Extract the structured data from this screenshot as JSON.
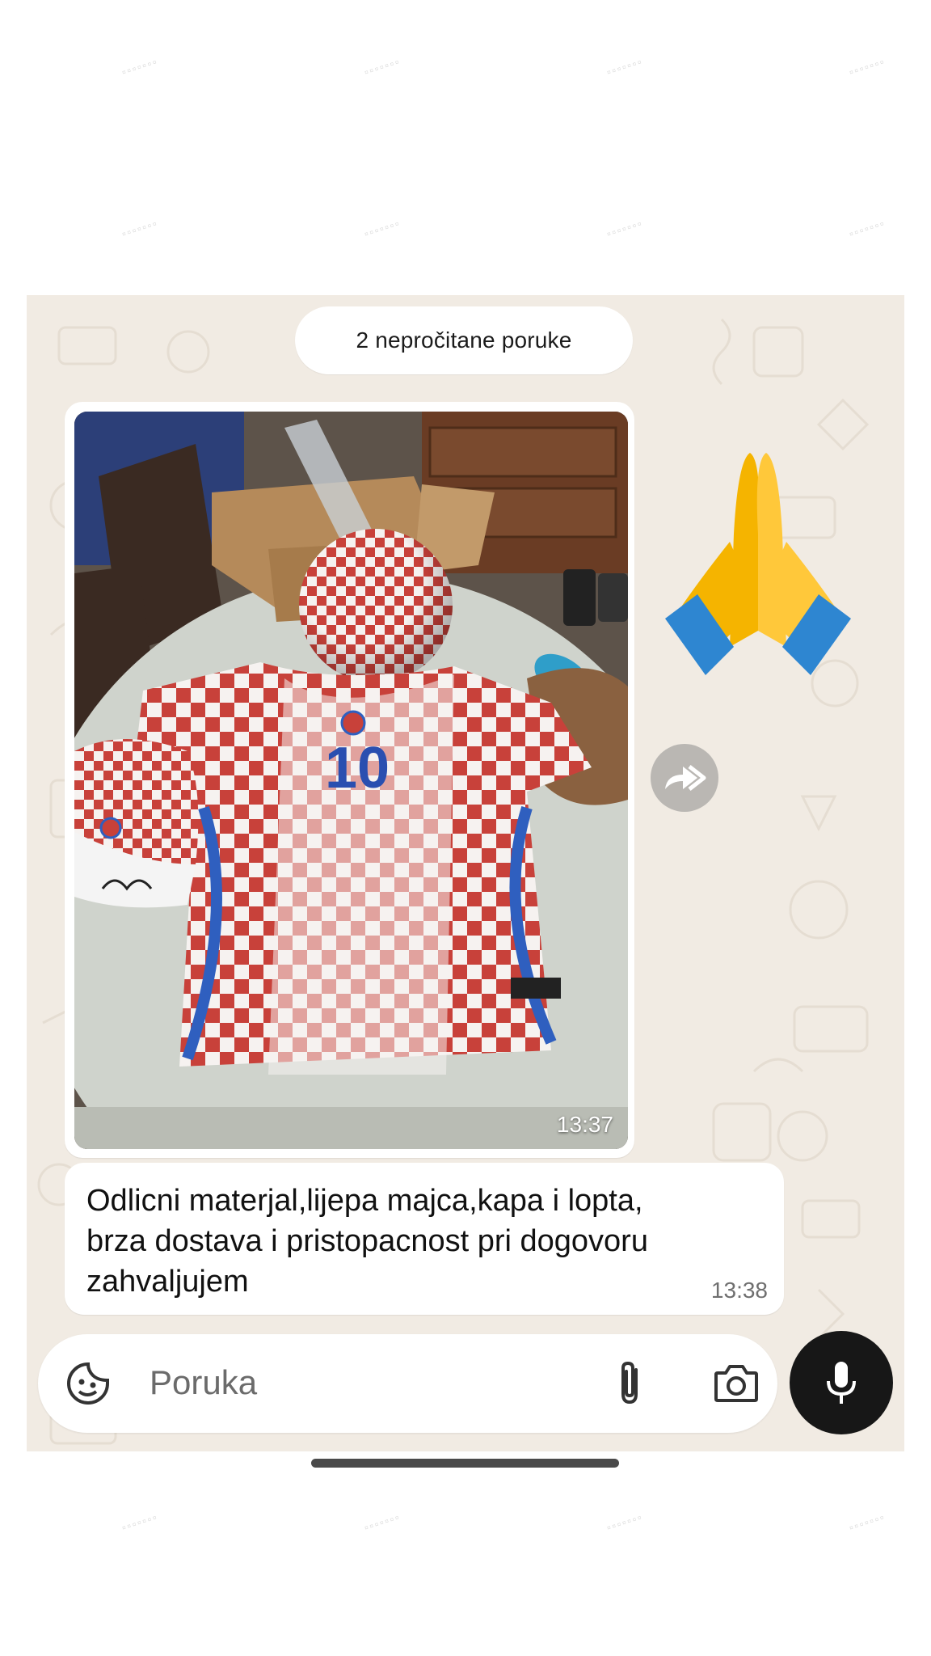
{
  "unread_banner": "2 nepročitane poruke",
  "image_message": {
    "time": "13:37",
    "jersey_number": "10"
  },
  "emoji_message": {
    "emoji": "folded-hands"
  },
  "text_message": {
    "lines": [
      "Odlicni materjal,lijepa majca,kapa i lopta,",
      "brza dostava i pristopacnost pri dogovoru",
      "zahvaljujem"
    ],
    "time": "13:38"
  },
  "composer": {
    "placeholder": "Poruka"
  },
  "icons": {
    "forward": "forward-icon",
    "sticker": "sticker-icon",
    "attach": "paperclip-icon",
    "camera": "camera-icon",
    "mic": "microphone-icon"
  },
  "colors": {
    "chat_bg": "#f1ebe3",
    "bubble": "#ffffff",
    "mic_button": "#171717"
  }
}
